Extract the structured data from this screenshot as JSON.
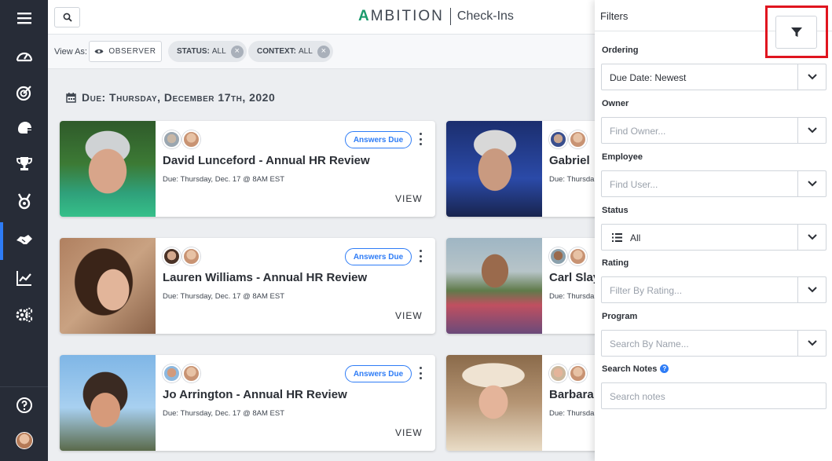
{
  "header": {
    "brand": "MBITION",
    "brand_first": "A",
    "app_name": "Check-Ins"
  },
  "filterbar": {
    "view_as_label": "View As:",
    "observer_label": "OBSERVER",
    "chips": [
      {
        "key": "STATUS:",
        "value": "ALL"
      },
      {
        "key": "CONTEXT:",
        "value": "ALL"
      }
    ]
  },
  "section": {
    "date_heading": "Due: Thursday, December 17th, 2020"
  },
  "cards_left": [
    {
      "title": "David Lunceford - Annual HR Review",
      "due": "Due: Thursday, Dec. 17 @ 8AM EST",
      "badge": "Answers Due",
      "view": "VIEW"
    },
    {
      "title": "Lauren Williams - Annual HR Review",
      "due": "Due: Thursday, Dec. 17 @ 8AM EST",
      "badge": "Answers Due",
      "view": "VIEW"
    },
    {
      "title": "Jo Arrington - Annual HR Review",
      "due": "Due: Thursday, Dec. 17 @ 8AM EST",
      "badge": "Answers Due",
      "view": "VIEW"
    }
  ],
  "cards_right": [
    {
      "title": "Gabriel",
      "due": "Due: Thursda"
    },
    {
      "title": "Carl Slay",
      "due": "Due: Thursda"
    },
    {
      "title": "Barbara",
      "due": "Due: Thursda"
    }
  ],
  "filters_panel": {
    "title": "Filters",
    "ordering": {
      "label": "Ordering",
      "value": "Due Date: Newest"
    },
    "owner": {
      "label": "Owner",
      "placeholder": "Find Owner..."
    },
    "employee": {
      "label": "Employee",
      "placeholder": "Find User..."
    },
    "status": {
      "label": "Status",
      "value": "All"
    },
    "rating": {
      "label": "Rating",
      "placeholder": "Filter By Rating..."
    },
    "program": {
      "label": "Program",
      "placeholder": "Search By Name..."
    },
    "notes": {
      "label": "Search Notes",
      "placeholder": "Search notes"
    }
  },
  "colors": {
    "sidebar": "#272c37",
    "accent": "#2e7cf6",
    "brand_green": "#1a9a6c",
    "highlight": "#e0151f"
  },
  "sidebar_icons": [
    "menu-icon",
    "dashboard-icon",
    "goals-icon",
    "coaching-icon",
    "trophy-icon",
    "medal-icon",
    "handshake-icon",
    "chart-icon",
    "settings-icon",
    "help-icon",
    "user-avatar"
  ]
}
